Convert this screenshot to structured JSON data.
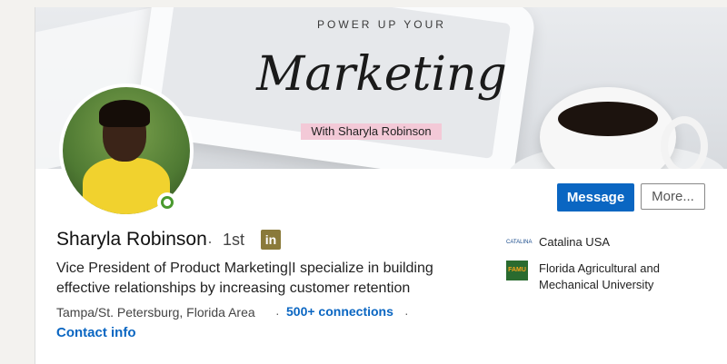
{
  "banner": {
    "top_text": "POWER UP YOUR",
    "script_text": "Marketing",
    "sub_text": "With Sharyla Robinson"
  },
  "actions": {
    "message_label": "Message",
    "more_label": "More..."
  },
  "profile": {
    "name": "Sharyla Robinson",
    "separator": "·",
    "degree": "1st",
    "linkedin_badge": "in",
    "headline": "Vice President of Product Marketing|I specialize in building effective relationships by increasing customer retention",
    "location": "Tampa/St. Petersburg, Florida Area",
    "connections": "500+ connections",
    "contact": "Contact info"
  },
  "experience": {
    "company_logo_text": "CATALINA",
    "company_name": "Catalina USA",
    "school_logo_text": "FAMU",
    "school_name": "Florida Agricultural and Mechanical University"
  },
  "colors": {
    "primary": "#0a66c2",
    "status_online": "#4a9a2e",
    "highlight": "#f3c9d7"
  }
}
